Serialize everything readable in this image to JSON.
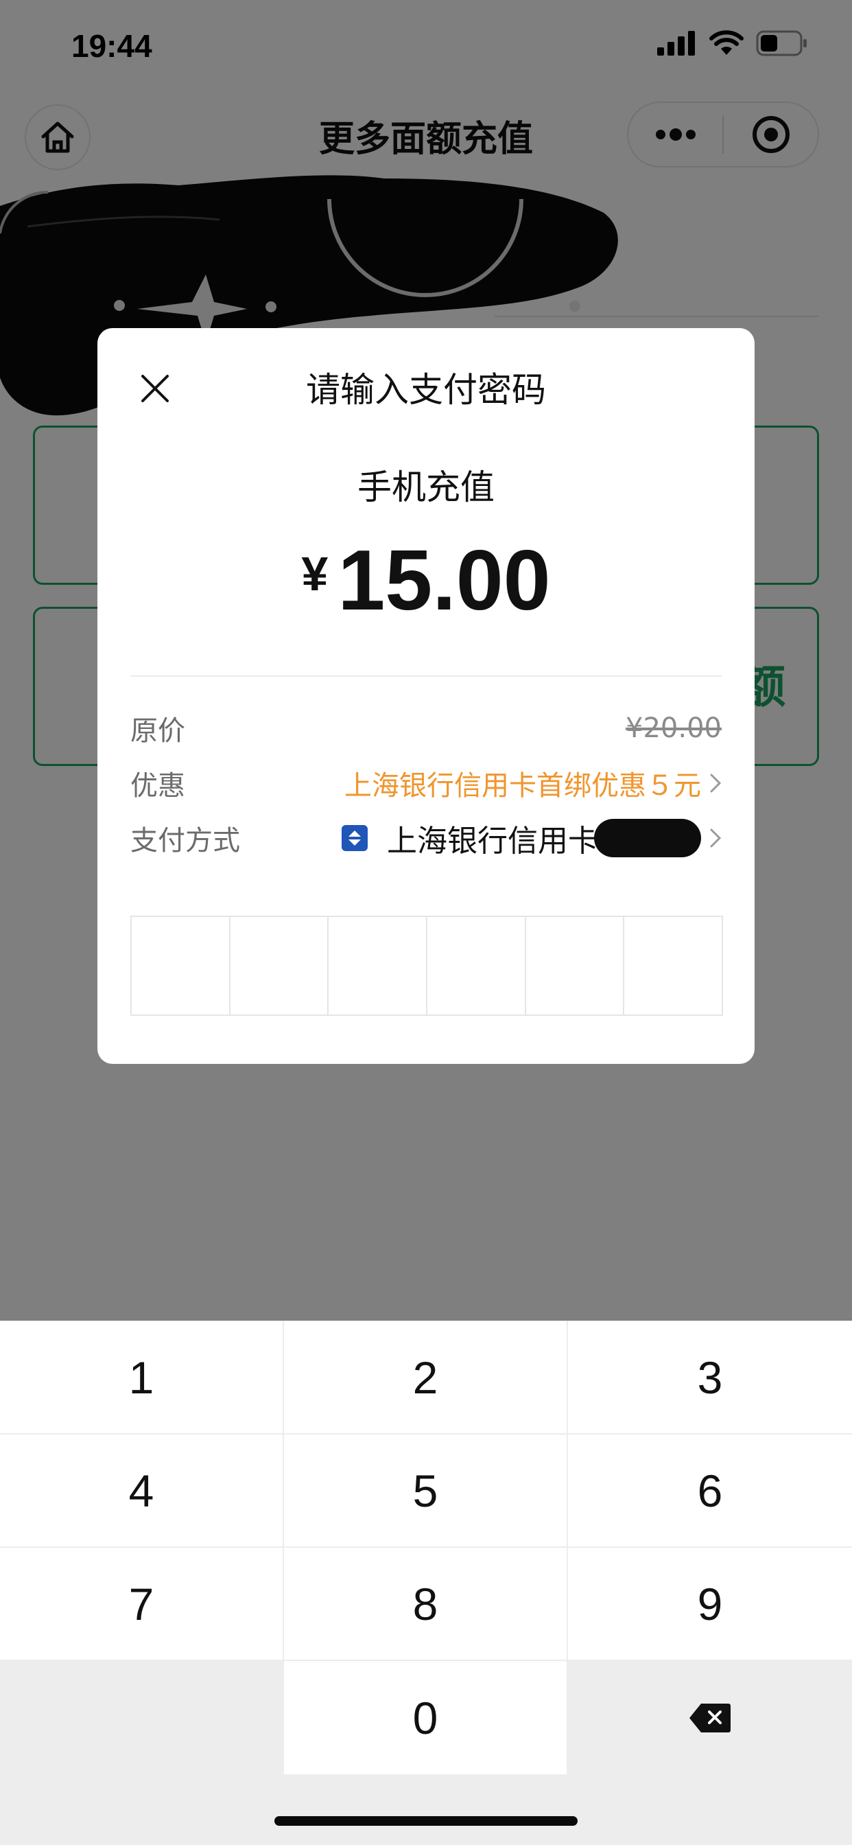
{
  "status_bar": {
    "time": "19:44"
  },
  "nav": {
    "title": "更多面额充值",
    "home_icon": "home-icon",
    "more_icon": "more-dots-icon",
    "target_icon": "target-icon"
  },
  "background": {
    "card_2_text": "额",
    "accent_color": "#1aa260"
  },
  "dialog": {
    "title": "请输入支付密码",
    "merchant": "手机充值",
    "currency": "¥",
    "amount": "15.00",
    "rows": {
      "original_price_label": "原价",
      "original_price_value": "¥20.00",
      "discount_label": "优惠",
      "discount_value": "上海银行信用卡首绑优惠５元",
      "method_label": "支付方式",
      "method_value": "上海银行信用卡"
    },
    "password_length": 6,
    "discount_color": "#f0952d"
  },
  "keypad": {
    "keys": [
      "1",
      "2",
      "3",
      "4",
      "5",
      "6",
      "7",
      "8",
      "9",
      "0"
    ],
    "delete_icon": "backspace-icon"
  }
}
